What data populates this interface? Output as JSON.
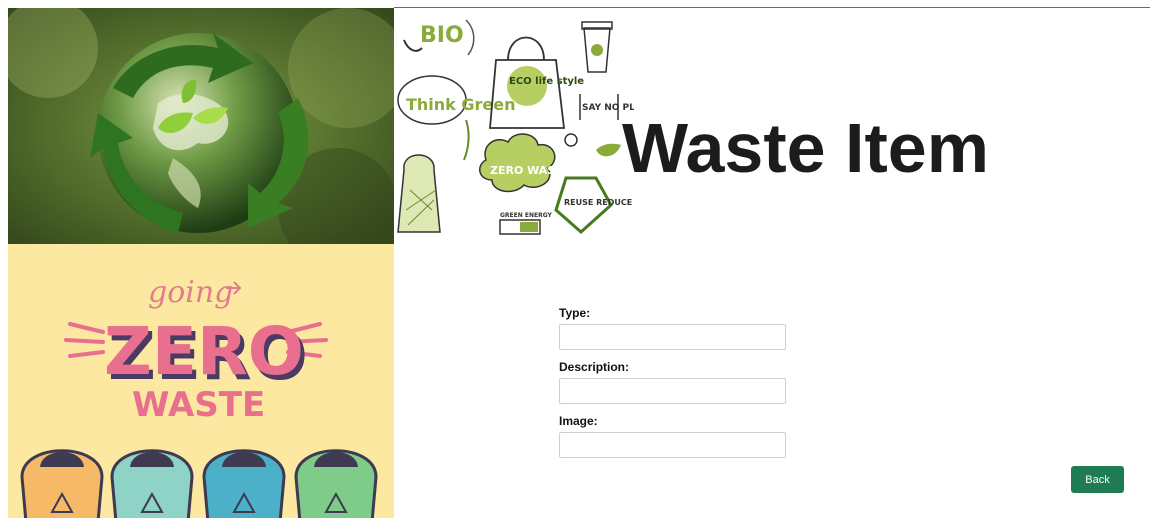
{
  "page": {
    "title": "Waste Item"
  },
  "images": {
    "eco_illustration_texts": [
      "BIO",
      "Think Green",
      "ECO life style",
      "SAY NO PLASTIC",
      "ZERO WASTE",
      "REUSE REDUCE RECYCLE",
      "GREEN ENERGY"
    ],
    "zero_waste_texts": [
      "going",
      "ZERO",
      "WASTE"
    ]
  },
  "form": {
    "type_label": "Type:",
    "type_value": "",
    "description_label": "Description:",
    "description_value": "",
    "image_label": "Image:",
    "image_value": ""
  },
  "actions": {
    "back_label": "Back"
  },
  "colors": {
    "accent_green": "#1e7b53",
    "leaf_green": "#8aaa3a",
    "poster_background": "#fce8a0",
    "zero_pink": "#e86f8e"
  }
}
